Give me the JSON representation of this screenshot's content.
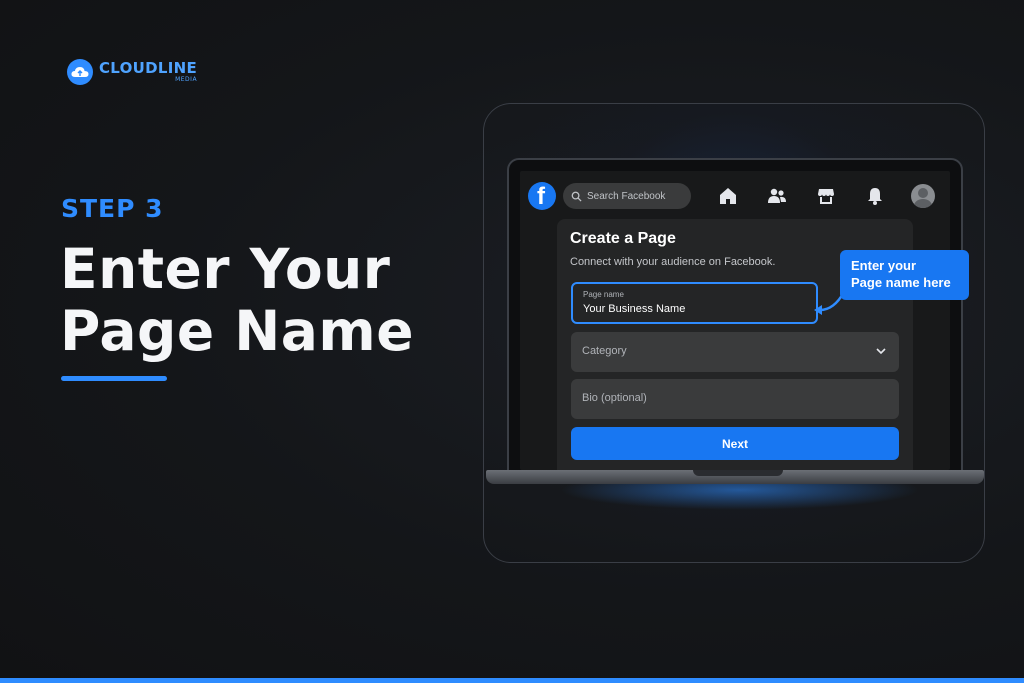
{
  "brand": {
    "name": "CLOUDLINE",
    "sub": "MEDIA"
  },
  "hero": {
    "step": "STEP 3",
    "title_line1": "Enter Your",
    "title_line2": "Page Name"
  },
  "facebook": {
    "search_placeholder": "Search Facebook",
    "card": {
      "title": "Create a Page",
      "subtitle": "Connect with your audience on Facebook.",
      "page_name_label": "Page name",
      "page_name_value": "Your Business Name",
      "category_placeholder": "Category",
      "bio_placeholder": "Bio (optional)",
      "next_label": "Next"
    }
  },
  "callout": {
    "line1": "Enter your",
    "line2": "Page name here"
  },
  "colors": {
    "accent": "#2f8cff",
    "facebook_blue": "#1877f2",
    "background": "#141619"
  },
  "icons": [
    "facebook-logo-icon",
    "search-icon",
    "home-icon",
    "friends-icon",
    "marketplace-icon",
    "bell-icon",
    "avatar-icon",
    "chevron-down-icon",
    "cloud-logo-icon"
  ]
}
